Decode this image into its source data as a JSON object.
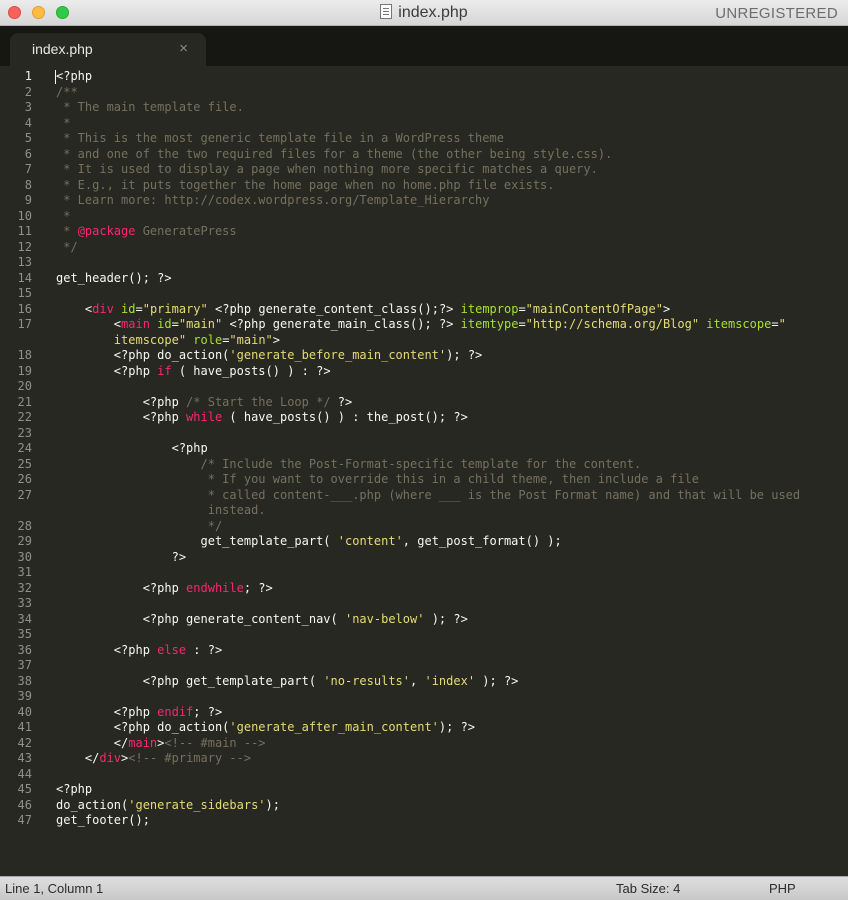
{
  "window": {
    "title": "index.php",
    "registration": "UNREGISTERED"
  },
  "tabs": [
    {
      "label": "index.php",
      "close_glyph": "×"
    }
  ],
  "editor": {
    "current_line": 1,
    "colors": {
      "background": "#272822",
      "text": "#f8f8f2",
      "comment": "#75715e",
      "keyword": "#f92672",
      "string": "#e6db74",
      "attribute": "#a6e22e",
      "line_number": "#8f908a"
    },
    "lines": [
      {
        "n": "1",
        "segments": [
          {
            "t": "<?php",
            "c": "txt"
          }
        ]
      },
      {
        "n": "2",
        "segments": [
          {
            "t": "/**",
            "c": "com"
          }
        ]
      },
      {
        "n": "3",
        "segments": [
          {
            "t": " * The main template file.",
            "c": "com"
          }
        ]
      },
      {
        "n": "4",
        "segments": [
          {
            "t": " *",
            "c": "com"
          }
        ]
      },
      {
        "n": "5",
        "segments": [
          {
            "t": " * This is the most generic template file in a WordPress theme",
            "c": "com"
          }
        ]
      },
      {
        "n": "6",
        "segments": [
          {
            "t": " * and one of the two required files for a theme (the other being style.css).",
            "c": "com"
          }
        ]
      },
      {
        "n": "7",
        "segments": [
          {
            "t": " * It is used to display a page when nothing more specific matches a query.",
            "c": "com"
          }
        ]
      },
      {
        "n": "8",
        "segments": [
          {
            "t": " * E.g., it puts together the home page when no home.php file exists.",
            "c": "com"
          }
        ]
      },
      {
        "n": "9",
        "segments": [
          {
            "t": " * Learn more: http://codex.wordpress.org/Template_Hierarchy",
            "c": "com"
          }
        ]
      },
      {
        "n": "10",
        "segments": [
          {
            "t": " *",
            "c": "com"
          }
        ]
      },
      {
        "n": "11",
        "segments": [
          {
            "t": " * ",
            "c": "com"
          },
          {
            "t": "@package",
            "c": "kw"
          },
          {
            "t": " GeneratePress",
            "c": "com"
          }
        ]
      },
      {
        "n": "12",
        "segments": [
          {
            "t": " */",
            "c": "com"
          }
        ]
      },
      {
        "n": "13",
        "segments": []
      },
      {
        "n": "14",
        "segments": [
          {
            "t": "get_header(); ?>",
            "c": "txt"
          }
        ]
      },
      {
        "n": "15",
        "segments": []
      },
      {
        "n": "16",
        "segments": [
          {
            "t": "    <",
            "c": "txt"
          },
          {
            "t": "div",
            "c": "kw"
          },
          {
            "t": " ",
            "c": "txt"
          },
          {
            "t": "id",
            "c": "attr"
          },
          {
            "t": "=",
            "c": "txt"
          },
          {
            "t": "\"primary\"",
            "c": "str"
          },
          {
            "t": " <?php generate_content_class();?> ",
            "c": "txt"
          },
          {
            "t": "itemprop",
            "c": "attr"
          },
          {
            "t": "=",
            "c": "txt"
          },
          {
            "t": "\"mainContentOfPage\"",
            "c": "str"
          },
          {
            "t": ">",
            "c": "txt"
          }
        ]
      },
      {
        "n": "17",
        "segments": [
          {
            "t": "        <",
            "c": "txt"
          },
          {
            "t": "main",
            "c": "kw"
          },
          {
            "t": " ",
            "c": "txt"
          },
          {
            "t": "id",
            "c": "attr"
          },
          {
            "t": "=",
            "c": "txt"
          },
          {
            "t": "\"main\"",
            "c": "str"
          },
          {
            "t": " <?php generate_main_class(); ?> ",
            "c": "txt"
          },
          {
            "t": "itemtype",
            "c": "attr"
          },
          {
            "t": "=",
            "c": "txt"
          },
          {
            "t": "\"http://schema.org/Blog\"",
            "c": "str"
          },
          {
            "t": " ",
            "c": "txt"
          },
          {
            "t": "itemscope",
            "c": "attr"
          },
          {
            "t": "=",
            "c": "txt"
          },
          {
            "t": "\"",
            "c": "str"
          }
        ]
      },
      {
        "n": "",
        "segments": [
          {
            "t": "        ",
            "c": "txt"
          },
          {
            "t": "itemscope\"",
            "c": "str"
          },
          {
            "t": " ",
            "c": "txt"
          },
          {
            "t": "role",
            "c": "attr"
          },
          {
            "t": "=",
            "c": "txt"
          },
          {
            "t": "\"main\"",
            "c": "str"
          },
          {
            "t": ">",
            "c": "txt"
          }
        ]
      },
      {
        "n": "18",
        "segments": [
          {
            "t": "        <?php do_action(",
            "c": "txt"
          },
          {
            "t": "'generate_before_main_content'",
            "c": "str"
          },
          {
            "t": "); ?>",
            "c": "txt"
          }
        ]
      },
      {
        "n": "19",
        "segments": [
          {
            "t": "        <?php ",
            "c": "txt"
          },
          {
            "t": "if",
            "c": "kw"
          },
          {
            "t": " ( have_posts() ) : ?>",
            "c": "txt"
          }
        ]
      },
      {
        "n": "20",
        "segments": []
      },
      {
        "n": "21",
        "segments": [
          {
            "t": "            <?php ",
            "c": "txt"
          },
          {
            "t": "/* Start the Loop */",
            "c": "com"
          },
          {
            "t": " ?>",
            "c": "txt"
          }
        ]
      },
      {
        "n": "22",
        "segments": [
          {
            "t": "            <?php ",
            "c": "txt"
          },
          {
            "t": "while",
            "c": "kw"
          },
          {
            "t": " ( have_posts() ) : the_post(); ?>",
            "c": "txt"
          }
        ]
      },
      {
        "n": "23",
        "segments": []
      },
      {
        "n": "24",
        "segments": [
          {
            "t": "                <?php",
            "c": "txt"
          }
        ]
      },
      {
        "n": "25",
        "segments": [
          {
            "t": "                    /* Include the Post-Format-specific template for the content.",
            "c": "com"
          }
        ]
      },
      {
        "n": "26",
        "segments": [
          {
            "t": "                     * If you want to override this in a child theme, then include a file",
            "c": "com"
          }
        ]
      },
      {
        "n": "27",
        "segments": [
          {
            "t": "                     * called content-___.php (where ___ is the Post Format name) and that will be used",
            "c": "com"
          }
        ]
      },
      {
        "n": "",
        "segments": [
          {
            "t": "                     instead.",
            "c": "com"
          }
        ]
      },
      {
        "n": "28",
        "segments": [
          {
            "t": "                     */",
            "c": "com"
          }
        ]
      },
      {
        "n": "29",
        "segments": [
          {
            "t": "                    get_template_part( ",
            "c": "txt"
          },
          {
            "t": "'content'",
            "c": "str"
          },
          {
            "t": ", get_post_format() );",
            "c": "txt"
          }
        ]
      },
      {
        "n": "30",
        "segments": [
          {
            "t": "                ?>",
            "c": "txt"
          }
        ]
      },
      {
        "n": "31",
        "segments": []
      },
      {
        "n": "32",
        "segments": [
          {
            "t": "            <?php ",
            "c": "txt"
          },
          {
            "t": "endwhile",
            "c": "kw"
          },
          {
            "t": "; ?>",
            "c": "txt"
          }
        ]
      },
      {
        "n": "33",
        "segments": []
      },
      {
        "n": "34",
        "segments": [
          {
            "t": "            <?php generate_content_nav( ",
            "c": "txt"
          },
          {
            "t": "'nav-below'",
            "c": "str"
          },
          {
            "t": " ); ?>",
            "c": "txt"
          }
        ]
      },
      {
        "n": "35",
        "segments": []
      },
      {
        "n": "36",
        "segments": [
          {
            "t": "        <?php ",
            "c": "txt"
          },
          {
            "t": "else",
            "c": "kw"
          },
          {
            "t": " : ?>",
            "c": "txt"
          }
        ]
      },
      {
        "n": "37",
        "segments": []
      },
      {
        "n": "38",
        "segments": [
          {
            "t": "            <?php get_template_part( ",
            "c": "txt"
          },
          {
            "t": "'no-results'",
            "c": "str"
          },
          {
            "t": ", ",
            "c": "txt"
          },
          {
            "t": "'index'",
            "c": "str"
          },
          {
            "t": " ); ?>",
            "c": "txt"
          }
        ]
      },
      {
        "n": "39",
        "segments": []
      },
      {
        "n": "40",
        "segments": [
          {
            "t": "        <?php ",
            "c": "txt"
          },
          {
            "t": "endif",
            "c": "kw"
          },
          {
            "t": "; ?>",
            "c": "txt"
          }
        ]
      },
      {
        "n": "41",
        "segments": [
          {
            "t": "        <?php do_action(",
            "c": "txt"
          },
          {
            "t": "'generate_after_main_content'",
            "c": "str"
          },
          {
            "t": "); ?>",
            "c": "txt"
          }
        ]
      },
      {
        "n": "42",
        "segments": [
          {
            "t": "        </",
            "c": "txt"
          },
          {
            "t": "main",
            "c": "kw"
          },
          {
            "t": ">",
            "c": "txt"
          },
          {
            "t": "<!-- #main -->",
            "c": "com"
          }
        ]
      },
      {
        "n": "43",
        "segments": [
          {
            "t": "    </",
            "c": "txt"
          },
          {
            "t": "div",
            "c": "kw"
          },
          {
            "t": ">",
            "c": "txt"
          },
          {
            "t": "<!-- #primary -->",
            "c": "com"
          }
        ]
      },
      {
        "n": "44",
        "segments": []
      },
      {
        "n": "45",
        "segments": [
          {
            "t": "<?php",
            "c": "txt"
          }
        ]
      },
      {
        "n": "46",
        "segments": [
          {
            "t": "do_action(",
            "c": "txt"
          },
          {
            "t": "'generate_sidebars'",
            "c": "str"
          },
          {
            "t": ");",
            "c": "txt"
          }
        ]
      },
      {
        "n": "47",
        "segments": [
          {
            "t": "get_footer();",
            "c": "txt"
          }
        ]
      }
    ]
  },
  "status": {
    "position": "Line 1, Column 1",
    "tab_size": "Tab Size: 4",
    "syntax": "PHP"
  }
}
